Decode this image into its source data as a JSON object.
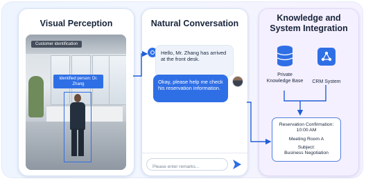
{
  "perception": {
    "title": "Visual Perception",
    "overlay_label": "Customer identification",
    "identified_label": "Identified person: Dr. Zhang"
  },
  "conversation": {
    "title": "Natural Conversation",
    "ai_message": "Hello, Mr. Zhang has arrived at the front desk.",
    "user_message": "Okay, please help me check his reservation information.",
    "input_placeholder": "Please enter remarks..."
  },
  "integration": {
    "title_line1": "Knowledge and",
    "title_line2": "System Integration",
    "kb_label": "Private Knowledge Base",
    "crm_label": "CRM System",
    "confirmation": {
      "heading": "Reservation Confirmation:",
      "time": "10:00 AM",
      "room": "Meeting Room A",
      "subject_label": "Subject:",
      "subject": "Business Negotiation"
    }
  },
  "colors": {
    "accent": "#2f6fe6",
    "title": "#17243a"
  },
  "icons": [
    "chatbot-avatar-icon",
    "user-avatar-icon",
    "send-icon",
    "database-icon",
    "crm-system-icon"
  ]
}
